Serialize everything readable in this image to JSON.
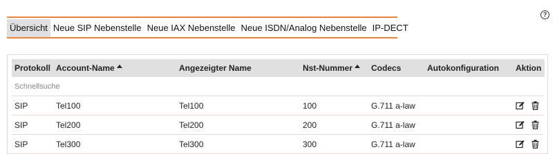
{
  "help": {
    "label": "?"
  },
  "tabs": [
    {
      "label": "Übersicht",
      "active": true
    },
    {
      "label": "Neue SIP Nebenstelle"
    },
    {
      "label": "Neue IAX Nebenstelle"
    },
    {
      "label": "Neue ISDN/Analog Nebenstelle"
    },
    {
      "label": "IP-DECT"
    }
  ],
  "table": {
    "columns": {
      "protokoll": "Protokoll",
      "account_name": "Account-Name",
      "angezeigter_name": "Angezeigter Name",
      "nst_nummer": "Nst-Nummer",
      "codecs": "Codecs",
      "autokonfiguration": "Autokonfiguration",
      "aktion": "Aktion"
    },
    "quick_search_placeholder": "Schnellsuche",
    "rows": [
      {
        "protokoll": "SIP",
        "account": "Tel100",
        "display": "Tel100",
        "nst": "100",
        "codecs": "G.711 a-law",
        "auto": ""
      },
      {
        "protokoll": "SIP",
        "account": "Tel200",
        "display": "Tel200",
        "nst": "200",
        "codecs": "G.711 a-law",
        "auto": ""
      },
      {
        "protokoll": "SIP",
        "account": "Tel300",
        "display": "Tel300",
        "nst": "300",
        "codecs": "G.711 a-law",
        "auto": ""
      }
    ]
  },
  "icons": {
    "edit": "edit-icon",
    "delete": "trash-icon",
    "sort": "sort-asc-icon"
  },
  "colors": {
    "accent": "#e8833a",
    "header_bg": "#e0e0e0",
    "row_border": "#ecdcd2"
  }
}
